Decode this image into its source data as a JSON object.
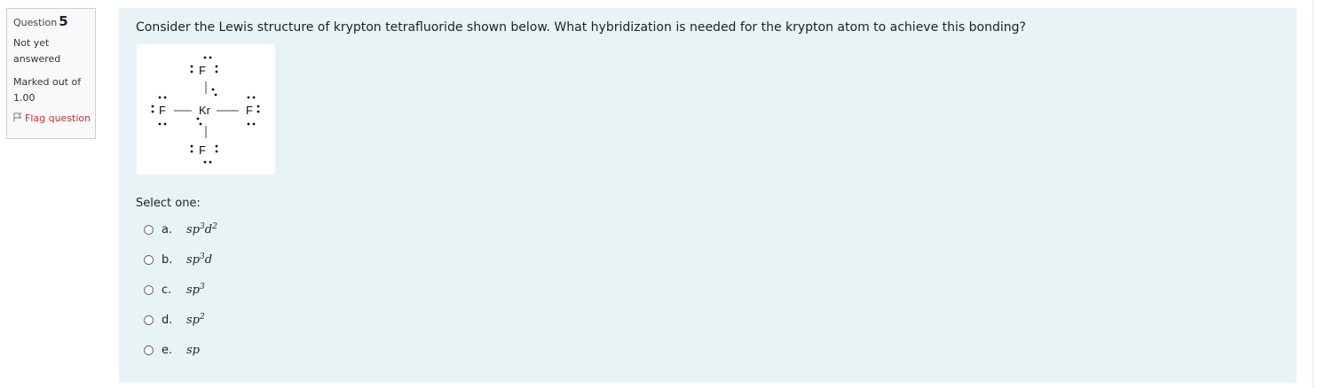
{
  "info": {
    "question_label": "Question",
    "question_number": "5",
    "state": "Not yet answered",
    "grade": "Marked out of 1.00",
    "flag_label": "Flag question"
  },
  "question": {
    "text": "Consider the Lewis structure of krypton tetrafluoride shown below.  What hybridization is needed for the krypton atom to achieve this bonding?",
    "lewis": {
      "center": "Kr",
      "ligand": "F"
    },
    "prompt": "Select one:",
    "options": [
      {
        "letter": "a.",
        "base": "sp",
        "sup1": "3",
        "mid": "d",
        "sup2": "2"
      },
      {
        "letter": "b.",
        "base": "sp",
        "sup1": "3",
        "mid": "d",
        "sup2": ""
      },
      {
        "letter": "c.",
        "base": "sp",
        "sup1": "3",
        "mid": "",
        "sup2": ""
      },
      {
        "letter": "d.",
        "base": "sp",
        "sup1": "2",
        "mid": "",
        "sup2": ""
      },
      {
        "letter": "e.",
        "base": "sp",
        "sup1": "",
        "mid": "",
        "sup2": ""
      }
    ]
  },
  "colors": {
    "background": "#e7f3f5",
    "flag": "#c5322c",
    "info_bg": "#f8f9fa"
  }
}
